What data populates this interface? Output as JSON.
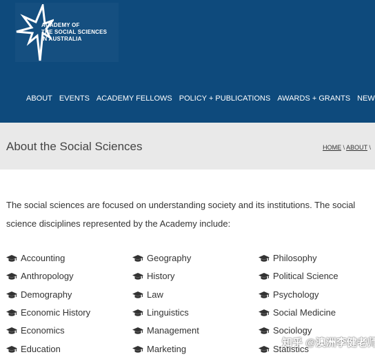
{
  "header": {
    "logo_lines": [
      "ACADEMY OF",
      "THE SOCIAL SCIENCES",
      "IN AUSTRALIA"
    ],
    "brand_color": "#0e4a7c",
    "logo_icon": "star-burst-logo"
  },
  "nav": {
    "items": [
      "ABOUT",
      "EVENTS",
      "ACADEMY FELLOWS",
      "POLICY + PUBLICATIONS",
      "AWARDS + GRANTS",
      "NEWS"
    ]
  },
  "page": {
    "title": "About the Social Sciences",
    "breadcrumb": [
      "HOME",
      "ABOUT"
    ],
    "breadcrumb_separator": "\\",
    "intro": "The social sciences are focused on understanding society and its institutions. The social science disciplines represented by the Academy include:"
  },
  "disciplines": {
    "icon": "graduation-cap-icon",
    "col1": [
      "Accounting",
      "Anthropology",
      "Demography",
      "Economic History",
      "Economics",
      "Education"
    ],
    "col2": [
      "Geography",
      "History",
      "Law",
      "Linguistics",
      "Management",
      "Marketing"
    ],
    "col3": [
      "Philosophy",
      "Political Science",
      "Psychology",
      "Social Medicine",
      "Sociology",
      "Statistics"
    ]
  },
  "watermark": "知乎 @澳洲李健老师"
}
